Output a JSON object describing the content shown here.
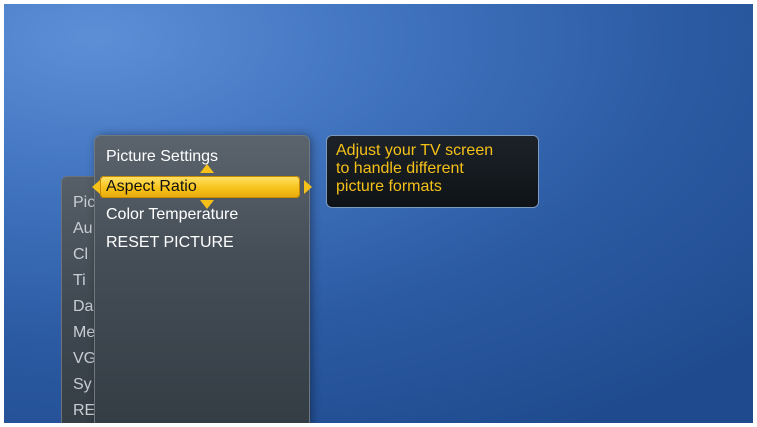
{
  "parent_menu": {
    "items": [
      "Pic",
      "Au",
      "Cl",
      "Ti",
      "Da",
      "Me",
      "VG",
      "Sy",
      "RE"
    ]
  },
  "menu": {
    "title": "Picture Settings",
    "selected_item": "Aspect Ratio",
    "items": [
      "Color Temperature",
      "RESET PICTURE"
    ]
  },
  "help": {
    "text": "Adjust your TV screen\nto handle different\npicture formats"
  },
  "icons": {
    "up": "arrow-up-icon",
    "down": "arrow-down-icon",
    "left": "arrow-left-icon",
    "right": "arrow-right-icon"
  },
  "colors": {
    "accent": "#f5c118",
    "background": "#3f72bd",
    "menu_text": "#ffffff"
  }
}
